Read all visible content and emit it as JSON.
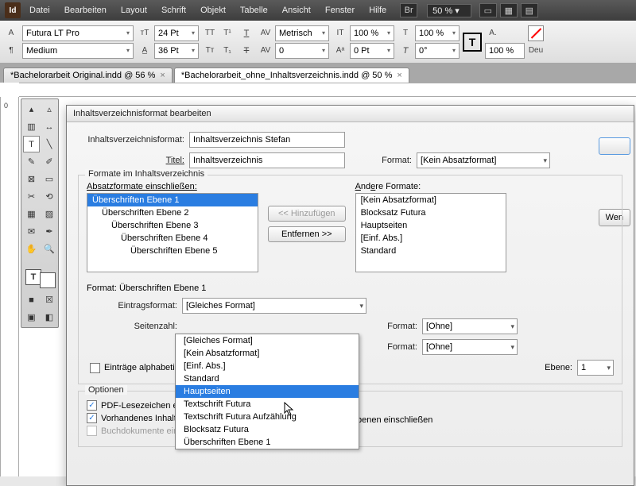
{
  "menubar": {
    "items": [
      "Datei",
      "Bearbeiten",
      "Layout",
      "Schrift",
      "Objekt",
      "Tabelle",
      "Ansicht",
      "Fenster",
      "Hilfe"
    ],
    "br": "Br",
    "zoom": "50 %"
  },
  "controlbar": {
    "font": "Futura LT Pro",
    "weight": "Medium",
    "fontsize": "24 Pt",
    "leading": "36 Pt",
    "kerningmode": "Metrisch",
    "tracking": "0",
    "vscale": "100 %",
    "hscale": "100 %",
    "baseline": "0 Pt",
    "skew": "0°",
    "fillpct": "100 %",
    "lang": "Deu"
  },
  "tabs": [
    {
      "label": "*Bachelorarbeit Original.indd @ 56 %"
    },
    {
      "label": "*Bachelorarbeit_ohne_Inhaltsverzeichnis.indd @ 50 %"
    }
  ],
  "ruler": {
    "zero": "0"
  },
  "dialog": {
    "title": "Inhaltsverzeichnisformat bearbeiten",
    "labels": {
      "tocformat": "Inhaltsverzeichnisformat:",
      "title": "Titel:",
      "format": "Format:",
      "included_legend": "Formate im Inhaltsverzeichnis",
      "include": "Absatzformate einschließen:",
      "other": "Andere Formate:",
      "add": "<< Hinzufügen",
      "remove": "Entfernen >>",
      "formatfor": "Format: Überschriften Ebene 1",
      "entryformat": "Eintragsformat:",
      "pagenum": "Seitenzahl:",
      "format_r": "Format:",
      "level": "Ebene:",
      "alpha": "Einträge alphabetisch",
      "options": "Optionen",
      "pdf": "PDF-Lesezeichen erste",
      "existing": "Vorhandenes Inhaltsv",
      "book": "Buchdokumente einsc",
      "hiddenlevels": "bl. Ebenen einschließen",
      "fewer": "Wen"
    },
    "values": {
      "tocformat": "Inhaltsverzeichnis Stefan",
      "title": "Inhaltsverzeichnis",
      "format": "[Kein Absatzformat]",
      "entryformat": "[Gleiches Format]",
      "format_r": "[Ohne]",
      "level": "1"
    },
    "includeList": [
      "Überschriften Ebene 1",
      "Überschriften Ebene 2",
      "Überschriften Ebene 3",
      "Überschriften Ebene 4",
      "Überschriften Ebene 5"
    ],
    "otherList": [
      "[Kein Absatzformat]",
      "Blocksatz Futura",
      "Hauptseiten",
      "[Einf. Abs.]",
      "Standard"
    ],
    "dropdown": [
      "[Gleiches Format]",
      "[Kein Absatzformat]",
      "[Einf. Abs.]",
      "Standard",
      "Hauptseiten",
      "Textschrift Futura",
      "Textschrift Futura Aufzählung",
      "Blocksatz Futura",
      "Überschriften Ebene 1"
    ],
    "dropdown_selected": 4
  }
}
